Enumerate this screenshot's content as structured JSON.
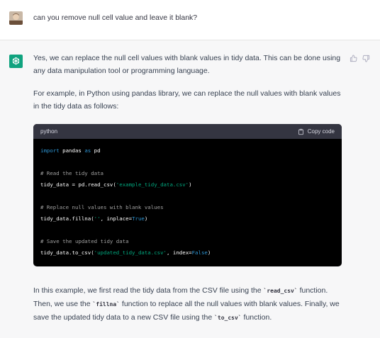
{
  "user_message": "can you remove null cell value and leave it blank?",
  "assistant": {
    "para1": [
      "Yes, we can replace the null cell values with blank values in tidy data. This can be done using",
      "any data manipulation tool or programming language."
    ],
    "para2": [
      "For example, in Python using pandas library, we can replace the null values with blank values",
      "in the tidy data as follows:"
    ],
    "code": {
      "language": "python",
      "copy_label": "Copy code",
      "import_kw": "import",
      "import_mod": " pandas ",
      "as_kw": "as",
      "import_alias": " pd",
      "comment1": "# Read the tidy data",
      "read_pre": "tidy_data = pd.read_csv(",
      "read_str": "'example_tidy_data.csv'",
      "read_post": ")",
      "comment2": "# Replace null values with blank values",
      "fill_pre": "tidy_data.fillna(",
      "fill_str": "''",
      "fill_mid": ", inplace=",
      "fill_bool": "True",
      "fill_post": ")",
      "comment3": "# Save the updated tidy data",
      "save_pre": "tidy_data.to_csv(",
      "save_str": "'updated_tidy_data.csv'",
      "save_mid": ", index=",
      "save_bool": "False",
      "save_post": ")"
    },
    "para3": {
      "l1_a": "In this example, we first read the tidy data from the CSV file using the ",
      "l1_code": "`read_csv`",
      "l1_b": " function.",
      "l2_a": "Then, we use the ",
      "l2_code": "`fillna`",
      "l2_b": " function to replace all the null values with blank values. Finally, we",
      "l3_a": "save the updated tidy data to a new CSV file using the ",
      "l3_code": "`to_csv`",
      "l3_b": " function."
    }
  },
  "colors": {
    "brand": "#10a37f",
    "code_bg": "#000000",
    "code_header_bg": "#343541",
    "keyword": "#2e95d3",
    "string": "#00a67d"
  },
  "icons": [
    "user-avatar",
    "openai-logo-icon",
    "thumbs-up-icon",
    "thumbs-down-icon",
    "clipboard-icon"
  ]
}
